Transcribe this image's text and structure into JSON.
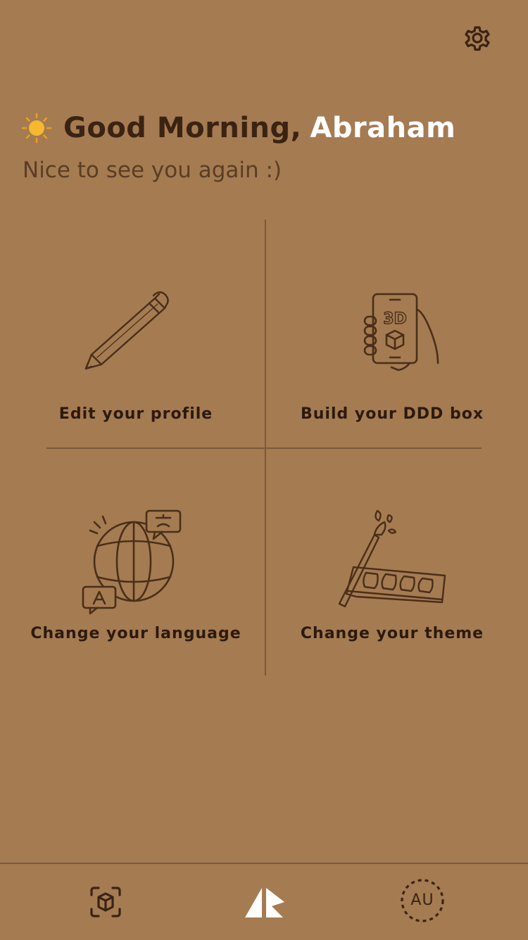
{
  "header": {
    "settings_icon": "gear-icon",
    "greeting_icon": "sun-icon",
    "greeting": "Good Morning,",
    "user_name": "Abraham",
    "subtitle": "Nice to see you again :)"
  },
  "tiles": [
    {
      "label": "Edit your profile",
      "icon": "pencil-icon"
    },
    {
      "label": "Build your DDD box",
      "icon": "phone-3d-icon"
    },
    {
      "label": "Change your language",
      "icon": "globe-translate-icon"
    },
    {
      "label": "Change your theme",
      "icon": "paint-palette-icon"
    }
  ],
  "phone_icon_text": "3D",
  "bottom_nav": {
    "left_icon": "ar-cube-scan-icon",
    "center_icon": "app-logo-icon",
    "avatar_initials": "AU"
  },
  "colors": {
    "background": "#a57b52",
    "text_dark": "#3a2312",
    "accent_white": "#ffffff",
    "sun": "#f5b82e"
  }
}
